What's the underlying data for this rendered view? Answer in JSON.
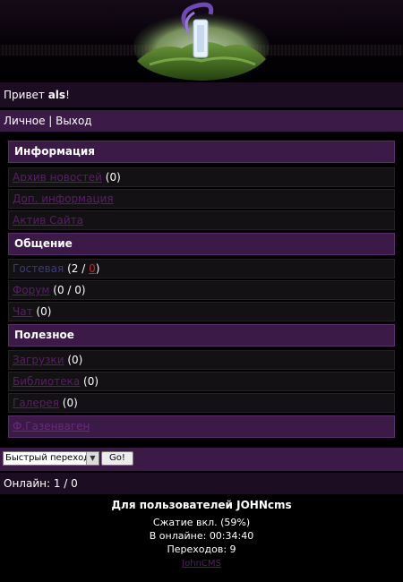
{
  "greeting": {
    "prefix": "Привет ",
    "user": "als",
    "suffix": "!"
  },
  "userbar": {
    "personal": "Личное",
    "separator": " | ",
    "logout": "Выход"
  },
  "sections": {
    "info": {
      "title": "Информация",
      "news_label": "Архив новостей",
      "news_count": " (0)",
      "extra_label": "Доп. информация",
      "asset_label": "Актив Сайта"
    },
    "chat": {
      "title": "Общение",
      "guest_label": "Гостевая",
      "guest_open": " (2 / ",
      "guest_new": "0",
      "guest_close": ")",
      "forum_label": "Форум",
      "forum_count": " (0 / 0)",
      "chat_label": "Чат",
      "chat_count": " (0)"
    },
    "useful": {
      "title": "Полезное",
      "downloads_label": "Загрузки",
      "downloads_count": " (0)",
      "library_label": "Библиотека",
      "library_count": " (0)",
      "gallery_label": "Галерея",
      "gallery_count": " (0)",
      "extra_link": "Ф.Газенваген"
    }
  },
  "quick_nav": {
    "selected": "Быстрый переход",
    "go_label": "Go!"
  },
  "online": "Онлайн: 1 / 0",
  "footer": {
    "title": "Для пользователей JOHNcms",
    "compression": "Сжатие вкл. (59%)",
    "online_time": "В онлайне: 00:34:40",
    "transitions": "Переходов: 9",
    "link": "JohnCMS"
  },
  "colors": {
    "bar": "#3b1a48",
    "dark_bar": "#1c0d22",
    "link": "#5c1c6c",
    "new_count": "#d02020"
  }
}
